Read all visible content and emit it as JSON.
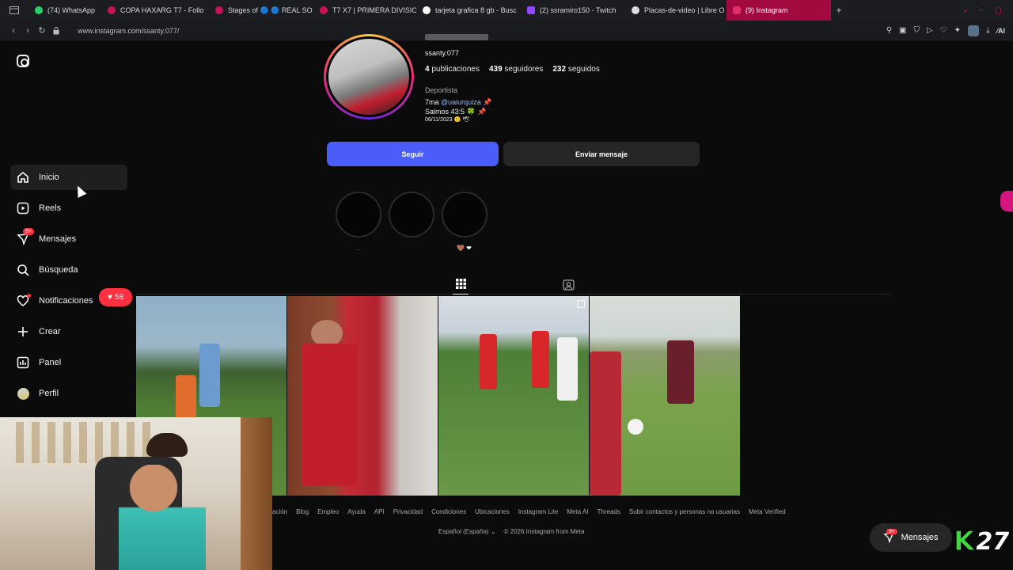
{
  "browser": {
    "tabs": [
      {
        "label": "(74) WhatsApp",
        "color": "#25d366"
      },
      {
        "label": "COPA HAXARG T7 - Follo",
        "color": "#c8135a"
      },
      {
        "label": "Stages of 🔵 🔵 REAL SO",
        "color": "#c8135a"
      },
      {
        "label": "T7 X7 | PRIMERA DIVISIO",
        "color": "#c8135a"
      },
      {
        "label": "tarjeta grafica 8 gb - Busc",
        "color": "#ffffff"
      },
      {
        "label": "(2) ssramiro150 - Twitch",
        "color": "#9146ff"
      },
      {
        "label": "Placas-de-video | Libre O",
        "color": "#dddddd"
      },
      {
        "label": "(9) Instagram",
        "color": "#e1306c"
      }
    ],
    "url": "www.instagram.com/ssanty.077/"
  },
  "sidebar": {
    "items": [
      {
        "label": "Inicio",
        "icon": "home-icon"
      },
      {
        "label": "Reels",
        "icon": "reels-icon"
      },
      {
        "label": "Mensajes",
        "icon": "messages-icon",
        "badge": "9+"
      },
      {
        "label": "Búsqueda",
        "icon": "search-icon"
      },
      {
        "label": "Notificaciones",
        "icon": "heart-icon"
      },
      {
        "label": "Crear",
        "icon": "plus-icon"
      },
      {
        "label": "Panel",
        "icon": "panel-icon"
      },
      {
        "label": "Perfil",
        "icon": "profile-avatar-icon"
      }
    ],
    "notifications_count": "58"
  },
  "profile": {
    "username": "ssanty.077",
    "stats": {
      "posts": "4",
      "posts_label": "publicaciones",
      "followers": "439",
      "followers_label": "seguidores",
      "following": "232",
      "following_label": "seguidos"
    },
    "category": "Deportista",
    "bio_line1_prefix": "7ma",
    "bio_mention": "@uaiurquiza",
    "bio_line2": "Salmos 43:5 🍀 📌",
    "bio_line3": "06/11/2023 🙂 🕊",
    "follow_label": "Seguir",
    "message_label": "Enviar mensaje",
    "highlights": [
      {
        "label": "."
      },
      {
        "label": ""
      },
      {
        "label": "🤎 ❤"
      }
    ]
  },
  "footer": {
    "links": [
      "ación",
      "Blog",
      "Empleo",
      "Ayuda",
      "API",
      "Privacidad",
      "Condiciones",
      "Ubicaciones",
      "Instagram Lite",
      "Meta AI",
      "Threads",
      "Subir contactos y personas no usuarias",
      "Meta Verified"
    ],
    "language": "Español (España)",
    "copyright": "© 2026 Instagram from Meta"
  },
  "floating_messages": {
    "label": "Mensajes",
    "badge": "9+"
  },
  "overlay_logo": {
    "k": "K",
    "n": "27"
  },
  "colors": {
    "follow_button": "#4a5df9",
    "notification_red": "#ff3040",
    "active_tab": "#a1093f"
  }
}
